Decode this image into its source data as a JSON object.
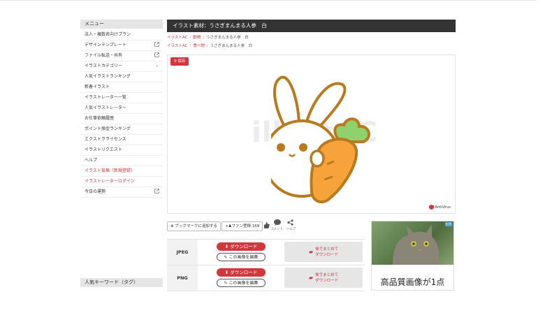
{
  "sidebar": {
    "header": "メニュー",
    "items": [
      {
        "label": "法人・複数名向けプラン"
      },
      {
        "label": "デザインテンプレート",
        "external": true
      },
      {
        "label": "ファイル転送・共有",
        "external": true
      },
      {
        "label": "イラストカテゴリー",
        "badge": "+"
      },
      {
        "label": "人気イラストランキング"
      },
      {
        "label": "新着イラスト"
      },
      {
        "label": "イラストレーター一覧"
      },
      {
        "label": "人気イラストレーター"
      },
      {
        "label": "お仕事依頼履歴"
      },
      {
        "label": "ポイント換金ランキング"
      },
      {
        "label": "エクストラライセンス"
      },
      {
        "label": "イラストリクエスト"
      },
      {
        "label": "ヘルプ"
      },
      {
        "label": "イラスト投稿（新規登録）",
        "red": true
      },
      {
        "label": "イラストレーターログイン",
        "red": true
      },
      {
        "label": "今日の運勢",
        "external": true
      }
    ],
    "keyword_header": "人気キーワード（タグ）"
  },
  "title": "イラスト素材：うさぎまんまる人参　白",
  "breadcrumbs": [
    {
      "root": "イラストAC",
      "category": "動物",
      "current": "うさぎまんまる人参　白"
    },
    {
      "root": "イラストAC",
      "category": "食べ物",
      "current": "うさぎまんまる人参　白"
    }
  ],
  "preview": {
    "save_label": "保存",
    "watermark": "illustAC",
    "antivirus": "AntiVirus"
  },
  "actions": {
    "bookmark": "ブックマークに追加する",
    "fan_label": "ファン登録",
    "fan_count": "169",
    "comment": "コメント",
    "share": "シェア"
  },
  "downloads": [
    {
      "format": "JPEG",
      "download": "ダウンロード",
      "edit": "この画像を編集",
      "bulk_line1": "後でまとめて",
      "bulk_line2": "ダウンロード"
    },
    {
      "format": "PNG",
      "download": "ダウンロード",
      "edit": "この画像を編集",
      "bulk_line1": "後でまとめて",
      "bulk_line2": "ダウンロード"
    }
  ],
  "ad": {
    "headline": "高品質画像が1点"
  },
  "colors": {
    "accent": "#d1373d",
    "title_bar": "#333333",
    "rabbit_outline": "#b87a1e",
    "carrot": "#f5a33a",
    "leaf": "#8fd16b"
  }
}
